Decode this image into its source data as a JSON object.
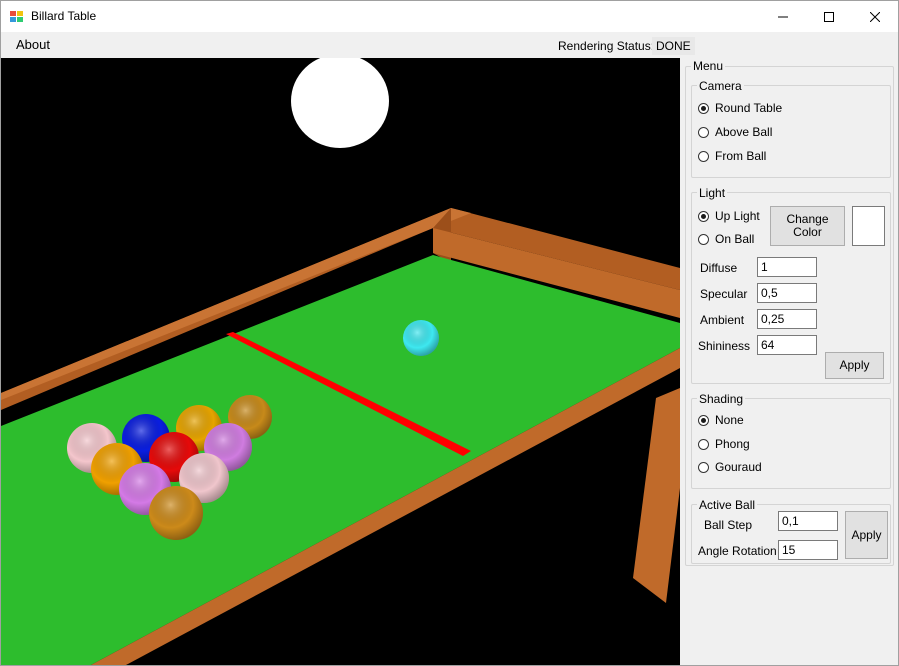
{
  "window": {
    "title": "Billard Table",
    "minimize_glyph": "─",
    "maximize_glyph": "☐",
    "close_glyph": "✕"
  },
  "menu": {
    "about": "About"
  },
  "status": {
    "label": "Rendering Status:",
    "value": "DONE"
  },
  "panel": {
    "title": "Menu",
    "camera": {
      "title": "Camera",
      "options": [
        "Round Table",
        "Above Ball",
        "From Ball"
      ],
      "selected": "Round Table"
    },
    "light": {
      "title": "Light",
      "options": [
        "Up Light",
        "On Ball"
      ],
      "selected": "Up Light",
      "change_color_label": "Change Color",
      "color": "#ffffff",
      "fields": [
        {
          "label": "Diffuse",
          "value": "1"
        },
        {
          "label": "Specular",
          "value": "0,5"
        },
        {
          "label": "Ambient",
          "value": "0,25"
        },
        {
          "label": "Shininess",
          "value": "64"
        }
      ],
      "apply_label": "Apply"
    },
    "shading": {
      "title": "Shading",
      "options": [
        "None",
        "Phong",
        "Gouraud"
      ],
      "selected": "None"
    },
    "active_ball": {
      "title": "Active Ball",
      "fields": [
        {
          "label": "Ball Step",
          "value": "0,1"
        },
        {
          "label": "Angle Rotation",
          "value": "15"
        }
      ],
      "apply_label": "Apply"
    }
  },
  "scene": {
    "background": "#000000",
    "felt_color": "#2dbd2d",
    "rail_color": "#c06a2a",
    "line_color": "#ff0000",
    "light_color": "#ffffff",
    "balls": [
      {
        "name": "cue-ball",
        "color": "#3ee8f0"
      },
      {
        "name": "ball",
        "color": "#f4c6cc"
      },
      {
        "name": "ball",
        "color": "#0a1ee0"
      },
      {
        "name": "ball",
        "color": "#e6a400"
      },
      {
        "name": "ball",
        "color": "#c78a1a"
      },
      {
        "name": "ball",
        "color": "#f0a000"
      },
      {
        "name": "ball",
        "color": "#e60a0a"
      },
      {
        "name": "ball",
        "color": "#d07ce0"
      },
      {
        "name": "ball",
        "color": "#d47ae6"
      },
      {
        "name": "ball",
        "color": "#f0c6cc"
      },
      {
        "name": "ball",
        "color": "#cc8a1a"
      }
    ]
  }
}
